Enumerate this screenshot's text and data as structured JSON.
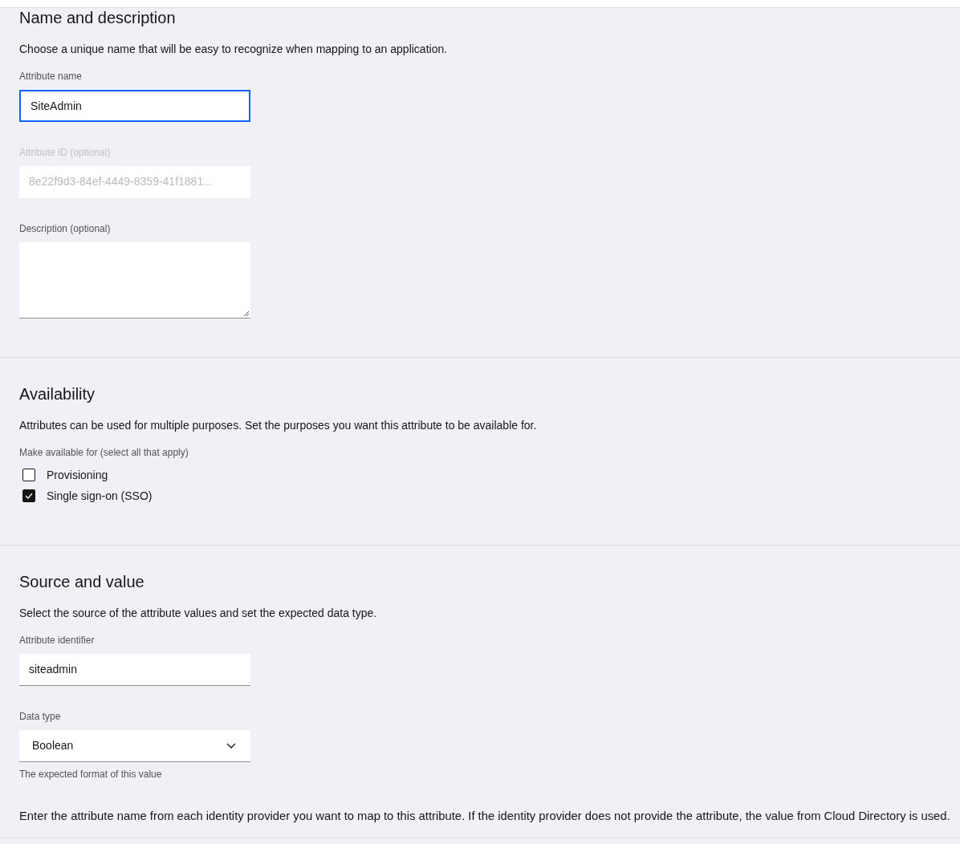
{
  "sections": [
    {
      "title": "Name and description",
      "description": "Choose a unique name that will be easy to recognize when mapping to an application.",
      "fields": [
        {
          "kind": "input",
          "label": "Attribute name",
          "value": "SiteAdmin",
          "focused": true,
          "disabled": false
        },
        {
          "kind": "input",
          "label": "Attribute ID (optional)",
          "value": "8e22f9d3-84ef-4449-8359-41f1881...",
          "focused": false,
          "disabled": true
        },
        {
          "kind": "textarea",
          "label": "Description (optional)"
        }
      ]
    },
    {
      "title": "Availability",
      "description": "Attributes can be used for multiple purposes. Set the purposes you want this attribute to be available for.",
      "fields": [
        {
          "kind": "checkboxes",
          "label": "Make available for (select all that apply)",
          "options": [
            {
              "label": "Provisioning",
              "checked": false
            },
            {
              "label": "Single sign-on (SSO)",
              "checked": true
            }
          ]
        }
      ]
    },
    {
      "title": "Source and value",
      "description": "Select the source of the attribute values and set the expected data type.",
      "fields": [
        {
          "kind": "input",
          "label": "Attribute identifier",
          "value": "siteadmin",
          "focused": false,
          "disabled": false
        },
        {
          "kind": "select",
          "label": "Data type",
          "value": "Boolean",
          "helper": "The expected format of this value"
        },
        {
          "kind": "note",
          "text": "Enter the attribute name from each identity provider you want to map to this attribute. If the identity provider does not provide the attribute, the value from Cloud Directory is used."
        }
      ]
    }
  ]
}
